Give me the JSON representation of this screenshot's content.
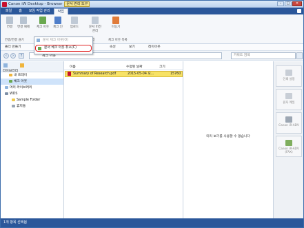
{
  "window": {
    "title": "Canon iW Desktop - Browser",
    "context_tab": "문서 관리 도구"
  },
  "tabs": [
    "파일",
    "홈",
    "모임 작업 관리",
    "작업"
  ],
  "ribbon": {
    "buttons": [
      "연결",
      "연결 해제",
      "체크 아웃",
      "체크 인",
      "업로드",
      "문서 버전 관리",
      "이동기"
    ],
    "groups": [
      "연결/연결 끊기",
      "관리",
      "체크 아웃 목록"
    ]
  },
  "dropdown": {
    "items": [
      "문서 체크 아웃(O)",
      "문서 체크 아웃 취소(C)"
    ]
  },
  "toolbar": {
    "new_folder": "폴더 만들기",
    "properties": "속성",
    "view": "보기",
    "layout": "레이아웃"
  },
  "address": {
    "path": "체크 아웃",
    "search_placeholder": "키워드 검색"
  },
  "left_pane": {
    "title": "라이브러리",
    "items": [
      "내 트레이",
      "체크 아웃",
      "머리 라이브러리",
      "WDS",
      "Sample Folder",
      "휴지통"
    ]
  },
  "files": {
    "columns": [
      "이름",
      "수정된 날짜",
      "크기"
    ],
    "rows": [
      {
        "name": "Summary of Research.pdf",
        "date": "2015-05-04 오...",
        "size": "15760"
      }
    ]
  },
  "preview": {
    "message": "미리 보기를 사용할 수 없습니다"
  },
  "right_panel": [
    "인쇄 설정",
    "원자 메일",
    "Canon iR-ADV",
    "Canon iR-ADV (FAX)"
  ],
  "status": "1개 항목 선택됨"
}
